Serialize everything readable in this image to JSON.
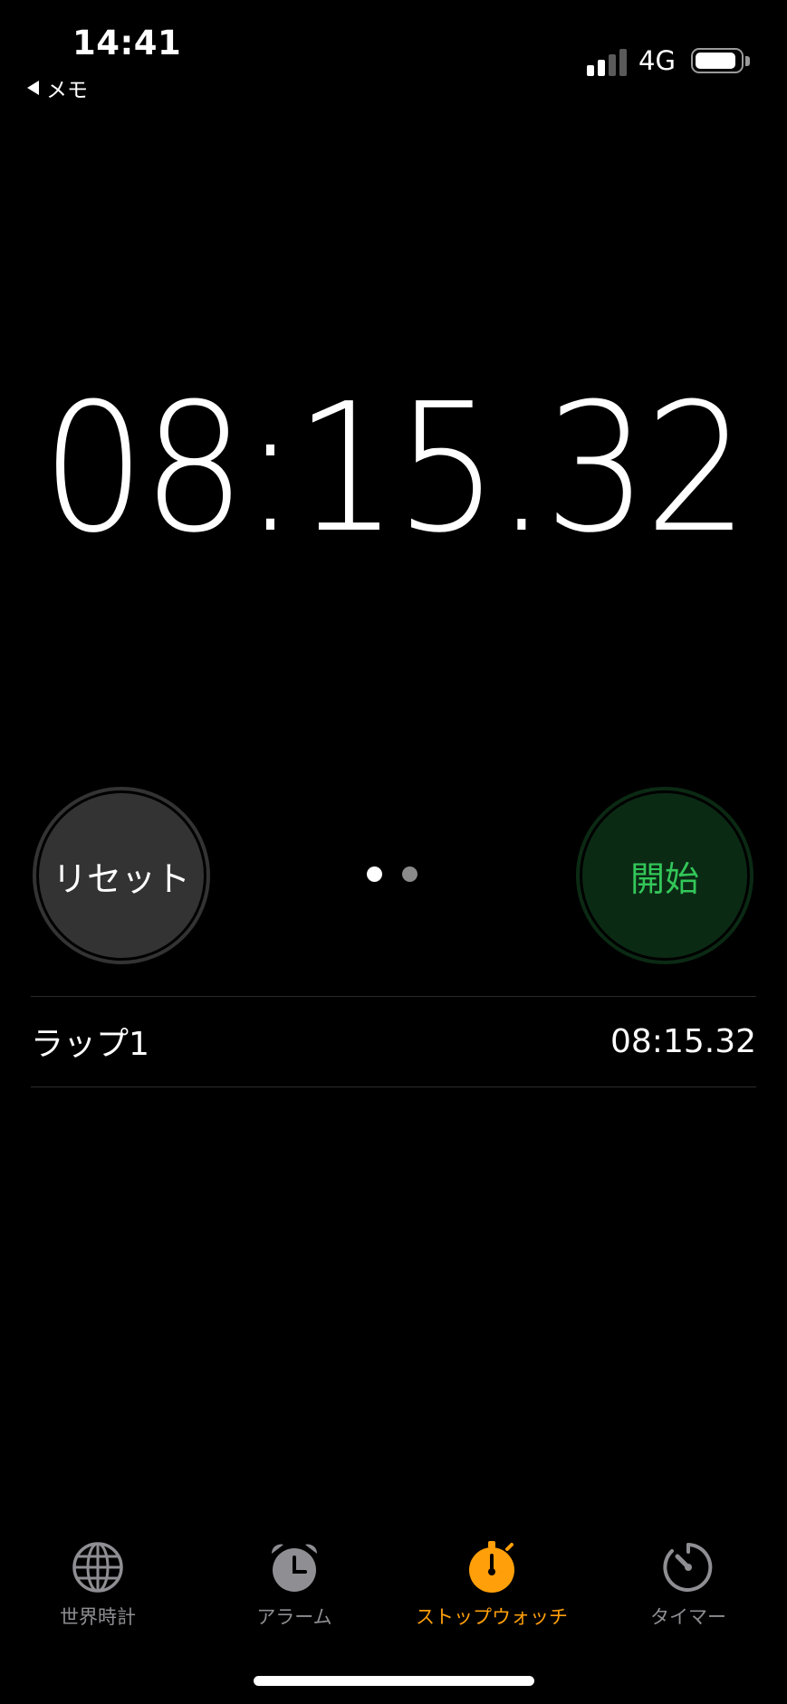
{
  "status_bar": {
    "time": "14:41",
    "back_label": "メモ",
    "network": "4G"
  },
  "stopwatch": {
    "elapsed": "08:15.32"
  },
  "buttons": {
    "reset_label": "リセット",
    "start_label": "開始"
  },
  "page_indicator": {
    "count": 2,
    "active_index": 0
  },
  "laps": [
    {
      "label": "ラップ1",
      "time": "08:15.32"
    }
  ],
  "tab_bar": {
    "tabs": [
      {
        "label": "世界時計",
        "icon": "globe-icon"
      },
      {
        "label": "アラーム",
        "icon": "alarm-clock-icon"
      },
      {
        "label": "ストップウォッチ",
        "icon": "stopwatch-icon",
        "active": true
      },
      {
        "label": "タイマー",
        "icon": "timer-icon"
      }
    ]
  },
  "colors": {
    "background": "#000000",
    "accent": "#ff9f0a",
    "start_green": "#33c759",
    "start_bg": "#0b2a14",
    "reset_bg": "#333333",
    "inactive_tab": "#8e8e93"
  }
}
